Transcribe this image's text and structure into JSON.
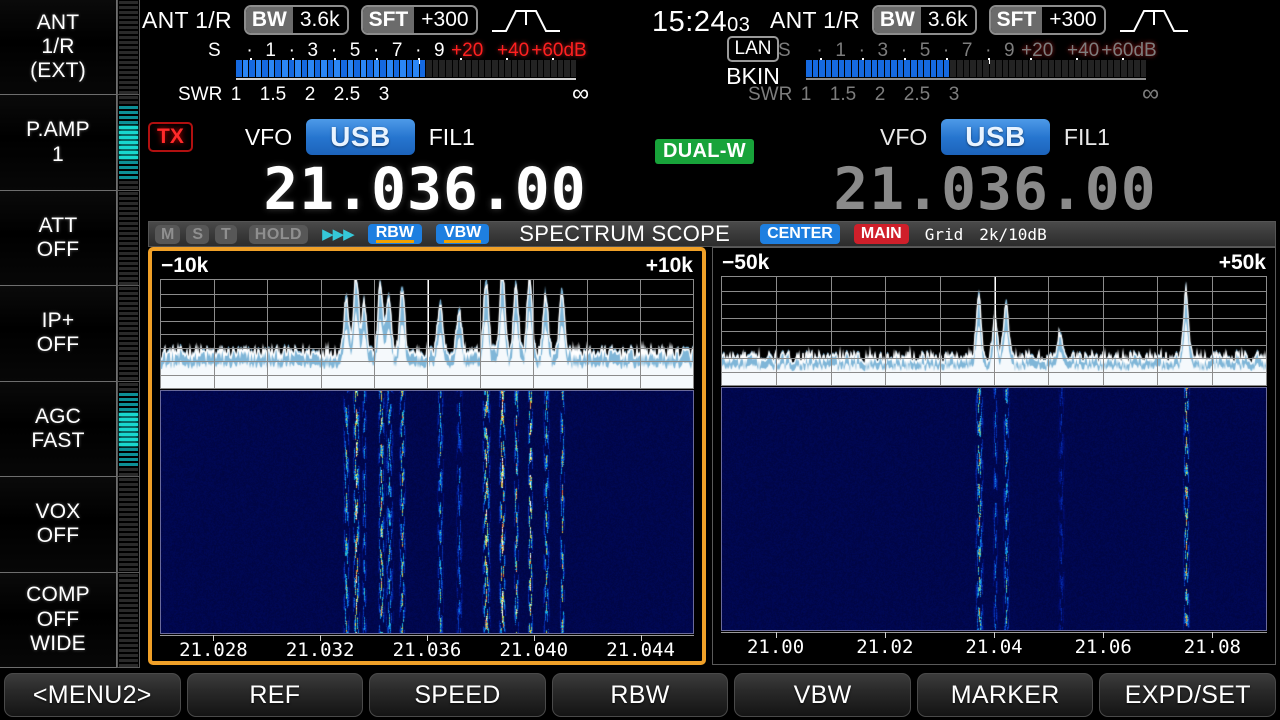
{
  "sidebar": {
    "items": [
      {
        "name": "ant",
        "lines": [
          "ANT",
          "1/R",
          "(EXT)"
        ],
        "meter": false
      },
      {
        "name": "pamp",
        "lines": [
          "P.AMP",
          "1"
        ],
        "meter": true
      },
      {
        "name": "att",
        "lines": [
          "ATT",
          "OFF"
        ],
        "meter": false
      },
      {
        "name": "ipplus",
        "lines": [
          "IP+",
          "OFF"
        ],
        "meter": false
      },
      {
        "name": "agc",
        "lines": [
          "AGC",
          "FAST"
        ],
        "meter": true
      },
      {
        "name": "vox",
        "lines": [
          "VOX",
          "OFF"
        ],
        "meter": false
      },
      {
        "name": "comp",
        "lines": [
          "COMP",
          "OFF",
          "WIDE"
        ],
        "meter": false
      }
    ]
  },
  "clock": {
    "time": "15:24",
    "seconds": "03"
  },
  "indicators": {
    "lan": "LAN",
    "bkin": "BKIN",
    "dual_watch": "DUAL-W",
    "tx": "TX"
  },
  "main_receiver": {
    "ant": "ANT 1/R",
    "bw_key": "BW",
    "bw_value": "3.6k",
    "sft_key": "SFT",
    "sft_value": "+300",
    "s_label": "S",
    "s_ticks": [
      "·",
      "1",
      "·",
      "3",
      "·",
      "5",
      "·",
      "7",
      "·",
      "9"
    ],
    "s_db_ticks": [
      "+20",
      "+40",
      "+60dB"
    ],
    "s_meter_lit_segments": 29,
    "s_meter_total_segments": 52,
    "swr_label": "SWR",
    "swr_ticks": [
      "1",
      "1.5",
      "2",
      "2.5",
      "3"
    ],
    "swr_infinity": "∞",
    "vfo_label": "VFO",
    "mode": "USB",
    "filter": "FIL1",
    "frequency": "21.036.00"
  },
  "sub_receiver": {
    "ant": "ANT 1/R",
    "bw_key": "BW",
    "bw_value": "3.6k",
    "sft_key": "SFT",
    "sft_value": "+300",
    "s_label": "S",
    "s_ticks": [
      "·",
      "1",
      "·",
      "3",
      "·",
      "5",
      "·",
      "7",
      "·",
      "9"
    ],
    "s_db_ticks": [
      "+20",
      "+40",
      "+60dB"
    ],
    "s_meter_lit_segments": 22,
    "s_meter_total_segments": 52,
    "swr_label": "SWR",
    "swr_ticks": [
      "1",
      "1.5",
      "2",
      "2.5",
      "3"
    ],
    "swr_infinity": "∞",
    "vfo_label": "VFO",
    "mode": "USB",
    "filter": "FIL1",
    "frequency": "21.036.00"
  },
  "scope_bar": {
    "mini_buttons": [
      "M",
      "S",
      "T"
    ],
    "hold": "HOLD",
    "arrows": "▶▶▶",
    "rbw": "RBW",
    "vbw": "VBW",
    "title": "SPECTRUM SCOPE",
    "center": "CENTER",
    "main": "MAIN",
    "grid": "Grid",
    "ref": "2k/10dB"
  },
  "scope_main": {
    "span_left": "−10k",
    "span_right": "+10k",
    "accent_color": "#f0a028",
    "axis_labels": [
      "21.028",
      "21.032",
      "21.036",
      "21.040",
      "21.044"
    ]
  },
  "scope_sub": {
    "span_left": "−50k",
    "span_right": "+50k",
    "axis_labels": [
      "21.00",
      "21.02",
      "21.04",
      "21.06",
      "21.08"
    ]
  },
  "softkeys": [
    "<MENU2>",
    "REF",
    "SPEED",
    "RBW",
    "VBW",
    "MARKER",
    "EXPD/SET"
  ],
  "chart_data": {
    "type": "line",
    "title": "SPECTRUM SCOPE",
    "panels": [
      {
        "name": "main-scope",
        "span": "±10k",
        "center_frequency_mhz": 21.036,
        "xlabel_ticks": [
          "21.028",
          "21.032",
          "21.036",
          "21.040",
          "21.044"
        ],
        "ref_level": "2k/10dB",
        "grid_vertical_divisions": 10,
        "grid_horizontal_divisions": 8,
        "noise_floor_pct": 12,
        "peaks": [
          {
            "x_pct": 34.2,
            "height_pct": 22
          },
          {
            "x_pct": 36.0,
            "height_pct": 30
          },
          {
            "x_pct": 37.5,
            "height_pct": 18
          },
          {
            "x_pct": 40.5,
            "height_pct": 26
          },
          {
            "x_pct": 42.0,
            "height_pct": 20
          },
          {
            "x_pct": 44.5,
            "height_pct": 24
          },
          {
            "x_pct": 51.5,
            "height_pct": 20
          },
          {
            "x_pct": 55.0,
            "height_pct": 16
          },
          {
            "x_pct": 60.0,
            "height_pct": 28
          },
          {
            "x_pct": 63.0,
            "height_pct": 32
          },
          {
            "x_pct": 65.5,
            "height_pct": 26
          },
          {
            "x_pct": 68.0,
            "height_pct": 30
          },
          {
            "x_pct": 71.0,
            "height_pct": 22
          },
          {
            "x_pct": 74.0,
            "height_pct": 24
          }
        ]
      },
      {
        "name": "sub-scope",
        "span": "±50k",
        "center_frequency_mhz": 21.04,
        "xlabel_ticks": [
          "21.00",
          "21.02",
          "21.04",
          "21.06",
          "21.08"
        ],
        "grid_vertical_divisions": 10,
        "grid_horizontal_divisions": 8,
        "noise_floor_pct": 9,
        "peaks": [
          {
            "x_pct": 47.0,
            "height_pct": 24
          },
          {
            "x_pct": 50.0,
            "height_pct": 16
          },
          {
            "x_pct": 52.0,
            "height_pct": 20
          },
          {
            "x_pct": 62.0,
            "height_pct": 10
          },
          {
            "x_pct": 85.0,
            "height_pct": 26
          }
        ]
      }
    ]
  }
}
